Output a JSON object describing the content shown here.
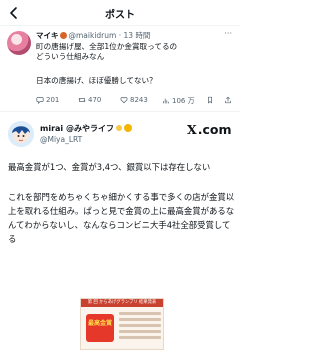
{
  "header": {
    "title": "ポスト"
  },
  "quoted_tweet": {
    "name": "マイキ",
    "handle": "@maikidrum",
    "separator": "·",
    "time": "13 時間",
    "more": "···",
    "text_line1": "町の唐揚げ屋、全部1位か金賞取ってるの",
    "text_line2": "どういう仕組みなん",
    "text_line3": "日本の唐揚げ、ほぼ優勝してない？",
    "stats": {
      "replies": "201",
      "retweets": "470",
      "likes": "8243",
      "views": "106 万"
    }
  },
  "main_tweet": {
    "name": "mirai @みやライフ",
    "handle": "@Miya_LRT",
    "brand": ".com",
    "brand_x": "X",
    "paragraph1": "最高金賞が1つ、金賞が3,4つ、銀賞以下は存在しない",
    "paragraph2": "これを部門をめちゃくちゃ細かくする事で多くの店が金賞以上を取れる仕組み。ぱっと見で金賞の上に最高金賞があるなんてわからないし、なんならコンビニ大手4社全部受賞してる",
    "image": {
      "header_text": "第 回 からあげグランプリ 結果発表",
      "badge_text": "最高金賞"
    }
  },
  "colors": {
    "accent": "#1d9bf0",
    "muted": "#536471",
    "border": "#eff3f4"
  }
}
